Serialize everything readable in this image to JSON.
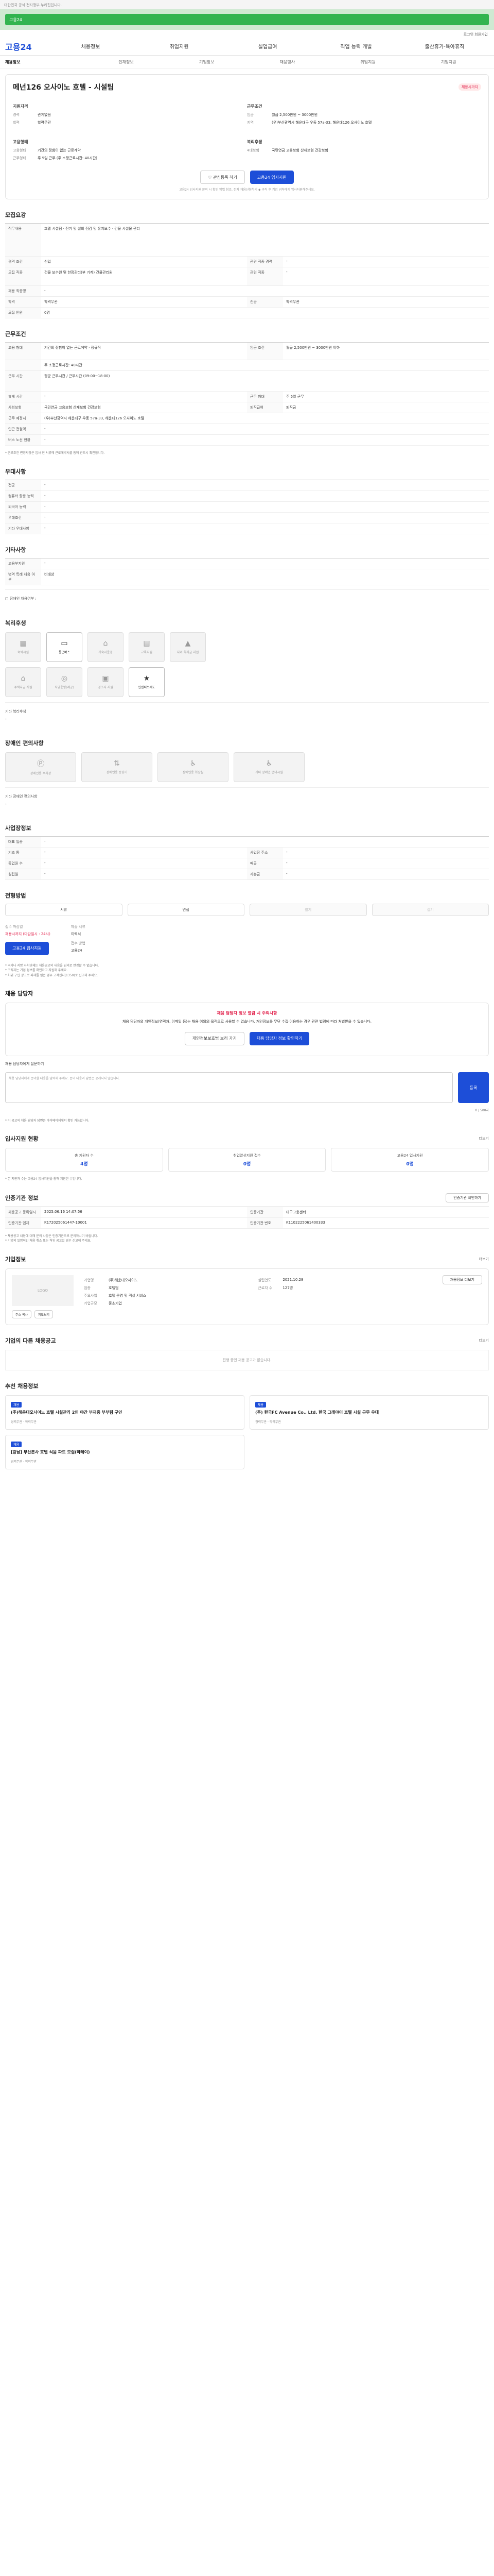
{
  "topbar": {
    "text": "대한민국 공식 전자정부 누리집입니다."
  },
  "banner": {
    "text": "고용24"
  },
  "util": {
    "text": "로그인  회원가입"
  },
  "gnb": {
    "logo": "고용24",
    "items": [
      "채용정보",
      "취업지원",
      "실업급여",
      "직업 능력 개발",
      "출산휴가·육아휴직"
    ]
  },
  "lnb": {
    "items": [
      "채용정보",
      "인재정보",
      "기업정보",
      "채용행사",
      "취업지원",
      "기업지원"
    ]
  },
  "job": {
    "title": "메넌126 오사이노 호텔 - 시설팀",
    "badge": "채용시까지",
    "recruit_h": "지원자격",
    "cond_h": "근무조건",
    "left": [
      {
        "k": "경력",
        "v": "관계없음"
      },
      {
        "k": "학력",
        "v": "학력무관"
      }
    ],
    "right": [
      {
        "k": "임금",
        "v": "월급 2,500만원 ~ 3000만원"
      },
      {
        "k": "지역",
        "v": "(우)부산광역시 해운대구 우동 57a-33, 해운대126 오사이노 호텔"
      }
    ],
    "pref_h": "고용형태",
    "benefit_h": "복리후생",
    "left2": [
      {
        "k": "고용형태",
        "v": "기간의 정함이 없는 근로계약"
      },
      {
        "k": "근무형태",
        "v": "주 5일 근무 (주 소정근로시간: 40시간)"
      }
    ],
    "right2": [
      {
        "k": "4대보험",
        "v": "국민연금 고용보험 산재보험 건강보험"
      }
    ],
    "btn_interest": "관심등록 하기",
    "btn_apply": "고용24 입사지원",
    "notice": "고용24 입사지원 문의 시 확인 방법 참조. 전자 채용신청하기 ◆ 구직 후 기업 귀하에게 입사지원해주세요."
  },
  "recruit": {
    "title": "모집요강",
    "rows": [
      {
        "k": "직무내용",
        "v": "호텔 시설팀 · 전기 및 설비 점검 및 유지보수 · 건물 시설물 관리"
      },
      {
        "k": "경력 조건",
        "v": "신입",
        "k2": "관련 직종 경력",
        "v2": "-"
      },
      {
        "k": "모집 직종",
        "v": "건물 보수원 및 한정관리(부 기계) 건물관리원",
        "k2": "관련 직종",
        "v2": "-"
      },
      {
        "k": "채용 직종명",
        "v": "-"
      },
      {
        "k": "학력",
        "v": "학력무관",
        "k2": "전공",
        "v2": "학력무관"
      },
      {
        "k": "모집 인원",
        "v": "0명"
      }
    ]
  },
  "condition": {
    "title": "근무조건",
    "rows": [
      {
        "k": "고용 형태",
        "v": "기간의 정함이 없는 근로계약 · 정규직",
        "k2": "임금 조건",
        "v2": "월급 2,500만원 ~ 3000만원 이하"
      },
      {
        "k": "",
        "v": "주 소정근로시간: 40시간"
      },
      {
        "k": "근무 시간",
        "v": "평균 근무시간 / 근무시간 (09:00~18:00)"
      },
      {
        "k": "휴게 시간",
        "v": "-",
        "k2": "근무 형태",
        "v2": "주 5일 근무"
      },
      {
        "k": "사회보험",
        "v": "국민연금 고용보험 산재보험 건강보험",
        "k2": "퇴직급여",
        "v2": "퇴직금"
      },
      {
        "k": "근무 예정지",
        "v": "(우)부산광역시 해운대구 우동 57a-33, 해운대126 오사이노 호텔"
      },
      {
        "k": "인근 전철역",
        "v": "-"
      },
      {
        "k": "버스 노선 현황",
        "v": "-"
      }
    ],
    "foot": "* 근로조건 변경사항은 입사 전 서류에 근로계약서를 통해 반드시 확인합니다."
  },
  "preference": {
    "title": "우대사항",
    "rows": [
      {
        "k": "전공",
        "v": "-"
      },
      {
        "k": "컴퓨터 활용 능력",
        "v": "-"
      },
      {
        "k": "외국어 능력",
        "v": "-"
      },
      {
        "k": "우대조건",
        "v": "-"
      },
      {
        "k": "기타 우대사항",
        "v": "-"
      }
    ]
  },
  "special": {
    "title": "기타사항",
    "rows": [
      {
        "k": "고용부지원",
        "v": "-"
      },
      {
        "k": "병역 특례 채용 여부",
        "v": "비대상"
      }
    ],
    "note": "□ 장애인 채용여부 :"
  },
  "welfare": {
    "title": "복리후생",
    "row1": [
      "숙박시설",
      "통근버스",
      "기숙사운영",
      "교육지원",
      "자녀 학자금 지원"
    ],
    "row2": [
      "주택자금 지원",
      "식당운영(제공)",
      "경조사 지원",
      "인센티브제도"
    ],
    "note_h": "기타 복리후생",
    "note": "-"
  },
  "disabled": {
    "title": "장애인 편의사항",
    "items": [
      "장애인용 주차장",
      "장애인용 승강기",
      "장애인용 화장실",
      "기타 장애인 편의시설"
    ],
    "note_h": "기타 장애인 편의사항",
    "note": "-"
  },
  "workplace": {
    "title": "사업장정보",
    "rows": [
      {
        "k": "대표 업종",
        "v": "-"
      },
      {
        "k": "기초 통",
        "v": "-",
        "k2": "사업장 주소",
        "v2": "-"
      },
      {
        "k": "종업원 수",
        "v": "-",
        "k2": "매출",
        "v2": "-"
      },
      {
        "k": "설립일",
        "v": "-",
        "k2": "자본금",
        "v2": "-"
      }
    ]
  },
  "method": {
    "title": "전형방법",
    "items": [
      "서류",
      "면접",
      "필기",
      "실기"
    ],
    "apply_k": "접수 마감일",
    "apply_v": "채용시까지 (마감일시 : 24시)",
    "doc_k": "제출 서류",
    "doc_v": "이력서",
    "way_k": "접수 방법",
    "way_v": "고용24",
    "btn": "고용24 입사지원",
    "notes": [
      "* 국가나 지방 자치단체는 채용공고의 내용을 임의로 변경할 수 없습니다.",
      "* 구직자는 기업 정보를 확인하고 지원해 주세요.",
      "* 허위 구인 광고로 피해를 입은 경우 고객센터(1350)로 신고해 주세요."
    ]
  },
  "manager": {
    "title": "채용 담당자",
    "warn_title": "채용 담당자 정보 열람 시 주의사항",
    "warn_text": "채용 담당자의 개인정보(연락처, 이메일 등)는 채용 이외의 목적으로 사용할 수 없습니다. 개인정보를 무단 수집·이용하는 경우 관련 법령에 따라 처벌받을 수 있습니다.",
    "btn1": "개인정보보호법 보러 가기",
    "btn2": "채용 담당자 정보 확인하기",
    "inq_h": "채용 담당자에게 질문하기",
    "inq_ph": "채용 담당자에게 문의할 내용을 입력해 주세요. 문의 내용과 답변은 공개되지 않습니다.",
    "inq_btn": "등록",
    "inq_count": "0 / 500자",
    "notes": [
      "* 이 공고의 채용 담당자 답변은 마이페이지에서 확인 가능합니다."
    ]
  },
  "status": {
    "title": "입사지원 현황",
    "more": "더보기",
    "items": [
      {
        "l": "총 지원자 수",
        "n": "4명"
      },
      {
        "l": "취업알선지원 접수",
        "n": "0명"
      },
      {
        "l": "고용24 입사지원",
        "n": "0명"
      }
    ],
    "note": "* 본 지원자 수는 고용24 입사지원을 통해 지원한 수입니다."
  },
  "info": {
    "title": "인증기관 정보",
    "btn": "인증기관 확인하기",
    "rows": [
      {
        "k": "채용공고 등록일시",
        "v": "2025.06.16 14:07:56",
        "k2": "인증기관",
        "v2": "대구고용센터"
      },
      {
        "k": "인증기관 업체",
        "v": "K172025061447-10001",
        "k2": "인증기관 번호",
        "v2": "K1102225061400333"
      }
    ],
    "notes": [
      "* 채용공고 내용에 대해 문의 사항은 인증기관으로 문의하시기 바랍니다.",
      "* 기업의 일방적인 채용 취소 또는 허위 공고일 경우 신고해 주세요."
    ]
  },
  "company": {
    "title": "기업정보",
    "more": "더보기",
    "logo": "LOGO",
    "rows": [
      {
        "k": "기업명",
        "v": "(주)해운대오사이노",
        "k2": "설립연도",
        "v2": "2021.10.28"
      },
      {
        "k": "업종",
        "v": "호텔업",
        "k2": "근로자 수",
        "v2": "127명"
      },
      {
        "k": "주요사업",
        "v": "호텔 운영 및 객실 서비스"
      },
      {
        "k": "기업규모",
        "v": "중소기업"
      }
    ],
    "btn1": "주소 복사",
    "btn2": "지도보기",
    "btn3": "채용정보 더보기"
  },
  "others": {
    "title": "기업의 다른 채용공고",
    "more": "더보기",
    "empty": "진행 중인 채용 공고가 없습니다."
  },
  "recommend": {
    "title": "추천 채용정보",
    "cards": [
      {
        "tag": "채용",
        "title": "(주)해운대오사이노 호텔 시설관리 2인 야간 부재중 부부팀 구인",
        "meta": "경력무관 · 학력무관"
      },
      {
        "tag": "채용",
        "title": "(주) 한국FC Avenue Co., Ltd. 한국 그래야이 호텔 시설 근무 우대",
        "meta": "경력무관 · 학력무관"
      },
      {
        "tag": "채용",
        "title": "[강남] 부산본사 호텔 식음 파트 모집(하레이)",
        "meta": "경력무관 · 학력무관"
      }
    ]
  }
}
